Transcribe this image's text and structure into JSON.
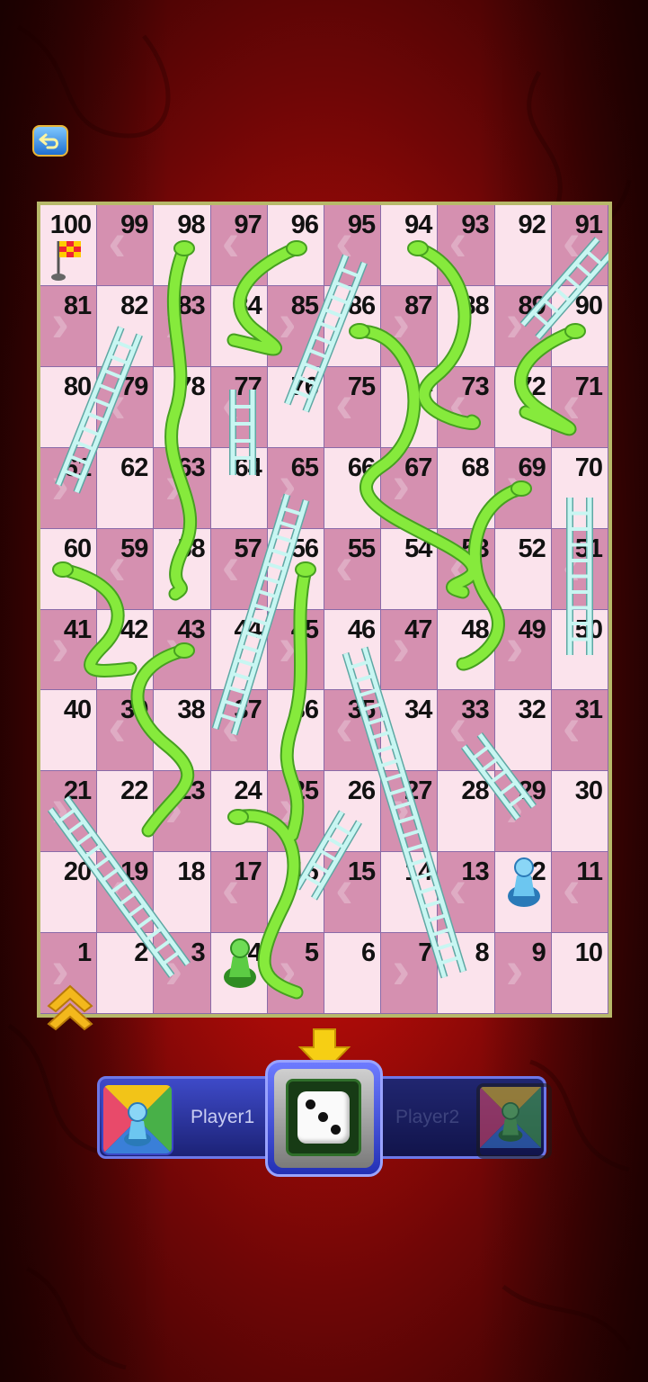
{
  "buttons": {
    "back_icon": "undo-arrow-icon"
  },
  "board": {
    "rows": [
      [
        100,
        99,
        98,
        97,
        96,
        95,
        94,
        93,
        92,
        91
      ],
      [
        81,
        82,
        83,
        84,
        85,
        86,
        87,
        88,
        89,
        90
      ],
      [
        80,
        79,
        78,
        77,
        76,
        75,
        74,
        73,
        72,
        71
      ],
      [
        61,
        62,
        63,
        64,
        65,
        66,
        67,
        68,
        69,
        70
      ],
      [
        60,
        59,
        58,
        57,
        56,
        55,
        54,
        53,
        52,
        51
      ],
      [
        41,
        42,
        43,
        44,
        45,
        46,
        47,
        48,
        49,
        50
      ],
      [
        40,
        39,
        38,
        37,
        36,
        35,
        34,
        33,
        32,
        31
      ],
      [
        21,
        22,
        23,
        24,
        25,
        26,
        27,
        28,
        29,
        30
      ],
      [
        20,
        19,
        18,
        17,
        16,
        15,
        14,
        13,
        12,
        11
      ],
      [
        1,
        2,
        3,
        4,
        5,
        6,
        7,
        8,
        9,
        10
      ]
    ],
    "colors": {
      "light": "#fbe3ec",
      "dark": "#d590b0",
      "snake": "#7ee33a",
      "ladder": "#bff3ef"
    }
  },
  "players": [
    {
      "label": "Player1",
      "token_color": "#58b8e8",
      "position": 12,
      "active": true
    },
    {
      "label": "Player2",
      "token_color": "#56c640",
      "position": 4,
      "active": false
    }
  ],
  "dice": {
    "value": 3
  }
}
